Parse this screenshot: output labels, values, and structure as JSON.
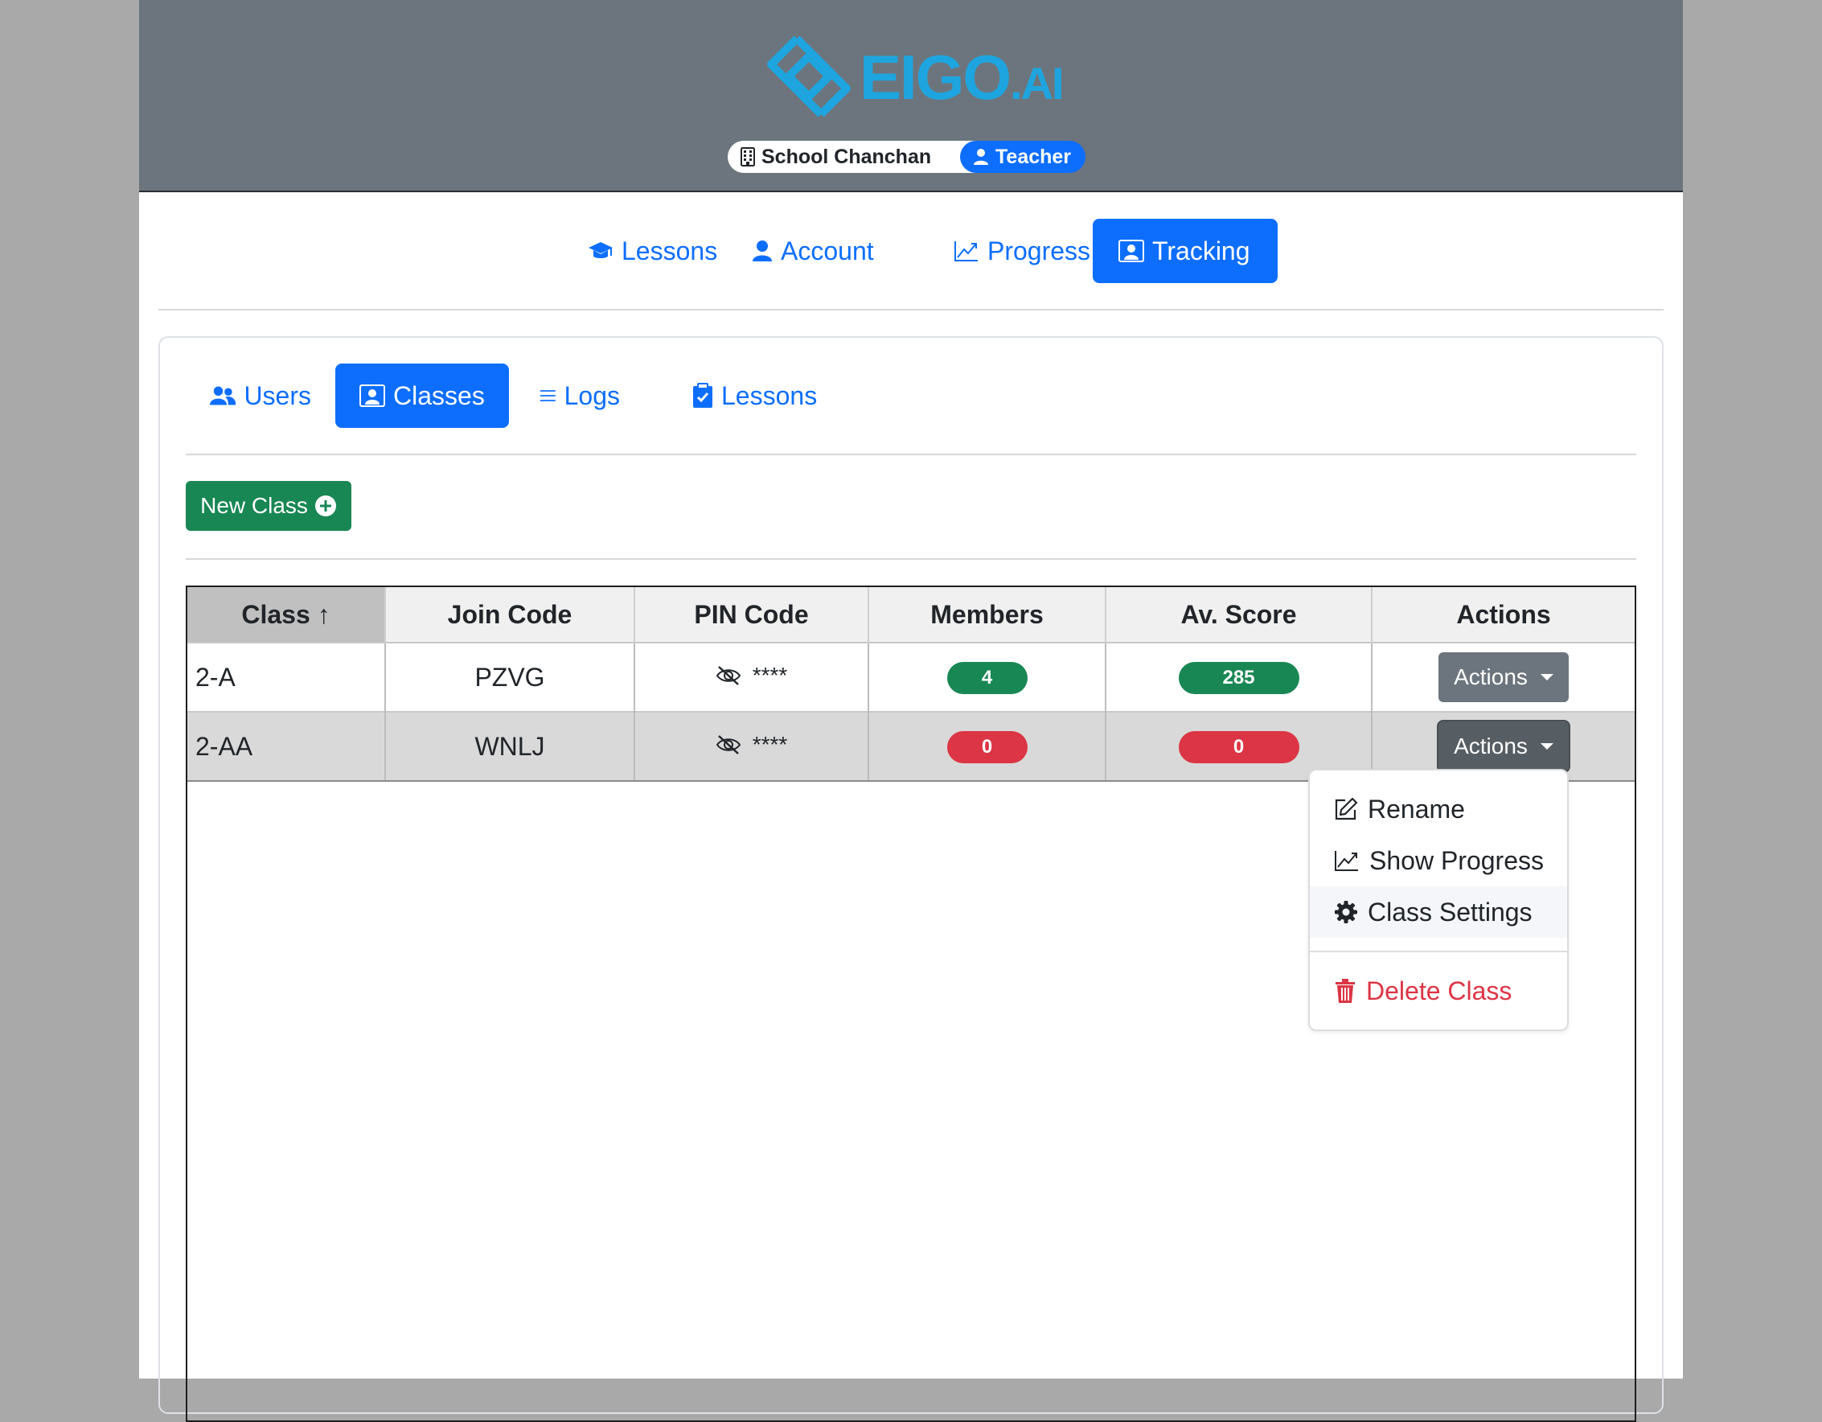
{
  "brand": {
    "logo_text": "EIGO",
    "logo_suffix": ".AI",
    "color": "#1ea5df"
  },
  "header": {
    "school_badge": "School Chanchan",
    "school_icon": "building-icon",
    "role_badge": "Teacher",
    "role_icon": "person-icon"
  },
  "main_nav": [
    {
      "label": "Lessons",
      "icon": "mortarboard-icon",
      "active": false
    },
    {
      "label": "Account",
      "icon": "person-icon",
      "active": false
    },
    {
      "label": "Progress",
      "icon": "graph-up-icon",
      "active": false
    },
    {
      "label": "Tracking",
      "icon": "person-video-icon",
      "active": true
    }
  ],
  "sub_nav": [
    {
      "label": "Users",
      "icon": "people-icon",
      "active": false
    },
    {
      "label": "Classes",
      "icon": "person-video-icon",
      "active": true
    },
    {
      "label": "Logs",
      "icon": "list-icon",
      "active": false
    },
    {
      "label": "Lessons",
      "icon": "clipboard-check-icon",
      "active": false
    }
  ],
  "new_class_button": "New Class",
  "table": {
    "headers": {
      "class": "Class",
      "sort_arrow": "↑",
      "join_code": "Join Code",
      "pin_code": "PIN Code",
      "members": "Members",
      "av_score": "Av. Score",
      "actions": "Actions"
    },
    "rows": [
      {
        "class": "2-A",
        "join_code": "PZVG",
        "pin": "****",
        "members": "4",
        "av_score": "285",
        "status": "green",
        "actions": "Actions"
      },
      {
        "class": "2-AA",
        "join_code": "WNLJ",
        "pin": "****",
        "members": "0",
        "av_score": "0",
        "status": "red",
        "actions": "Actions"
      }
    ]
  },
  "dropdown": {
    "rename": "Rename",
    "show_progress": "Show Progress",
    "class_settings": "Class Settings",
    "delete_class": "Delete Class"
  },
  "colors": {
    "primary": "#0d6efd",
    "success": "#198754",
    "danger": "#dc3545",
    "secondary": "#6c757d"
  }
}
